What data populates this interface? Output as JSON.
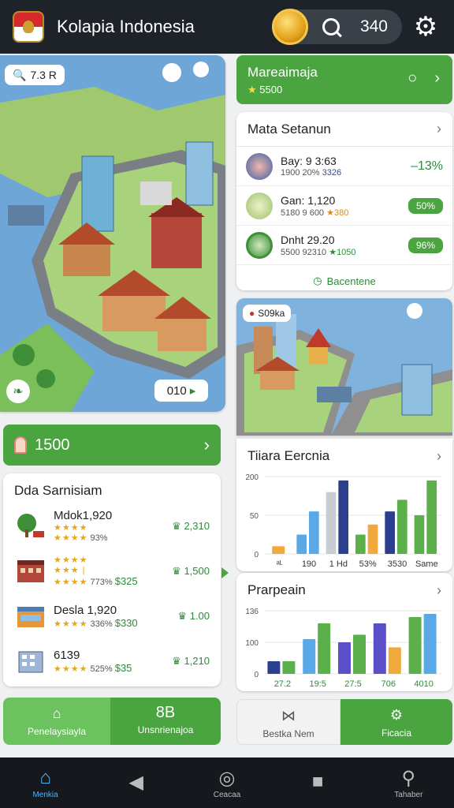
{
  "header": {
    "title": "Kolapia Indonesia",
    "coin_count": "340"
  },
  "map": {
    "tag": "7.3 R",
    "bottom_badge": "010"
  },
  "left_banner": {
    "value": "1500"
  },
  "right_banner": {
    "title": "Mareaimaja",
    "subtitle": "5500"
  },
  "stats": {
    "title": "Mata Setanun",
    "rows": [
      {
        "main": "Bay: 9 3:63",
        "sub_a": "1900 20%",
        "sub_b": "3326",
        "right": "–13%"
      },
      {
        "main": "Gan: 1,120",
        "sub_a": "5180 9 600",
        "sub_b": "380",
        "right": "50%"
      },
      {
        "main": "Dnht 29.20",
        "sub_a": "5500 92310",
        "sub_b": "1050",
        "right": "96%"
      }
    ],
    "link": "Bacentene"
  },
  "city_tag": "S09ka",
  "list": {
    "title": "Dda Sarnisiam",
    "items": [
      {
        "name": "Mdok1,920",
        "stars_a": "★★★★",
        "stars_b": "★★★★",
        "sub": "93%",
        "price": "2,310"
      },
      {
        "name": "",
        "stars_a": "★★★★",
        "stars_b": "★★★ |",
        "stars_c": "★★★★",
        "sub": "773%",
        "sub_b": "$325",
        "price": "1,500"
      },
      {
        "name": "Desla 1,920",
        "stars_a": "★★★★",
        "sub": "336%",
        "sub_b": "$330",
        "price": "1.00"
      },
      {
        "name": "6139",
        "stars_a": "★★★★",
        "sub": "525%",
        "sub_b": "$35",
        "price": "1,210"
      }
    ]
  },
  "tabs": {
    "left_a": "Penelaysiayla",
    "left_b_icon": "8B",
    "left_b": "Unsnrienajoa",
    "right_a": "Bestka Nem",
    "right_b": "Ficacia"
  },
  "nav": {
    "home": "Menkia",
    "center": "Ceacaa",
    "search": "Tahaber"
  },
  "chart_data": [
    {
      "type": "bar",
      "title": "Tiiara Eercnia",
      "yticks": [
        "200",
        "50",
        "0"
      ],
      "categories": [
        "ᵃᴸ",
        "190",
        "1 Hd",
        "53%",
        "3530",
        "Same"
      ],
      "series": [
        {
          "color": "#f2a93b",
          "values": [
            10,
            0,
            0,
            0,
            0,
            0
          ]
        },
        {
          "color": "#5aa9e6",
          "values": [
            0,
            25,
            55,
            0,
            0,
            0
          ]
        },
        {
          "color": "#c8cdd4",
          "values": [
            0,
            0,
            80,
            0,
            0,
            0
          ]
        },
        {
          "color": "#2c3f8f",
          "values": [
            0,
            0,
            95,
            0,
            0,
            0
          ]
        },
        {
          "color": "#5cb04b",
          "values": [
            0,
            0,
            0,
            25,
            70,
            95
          ]
        },
        {
          "color": "#f2a93b",
          "values": [
            0,
            0,
            0,
            38,
            0,
            0
          ]
        },
        {
          "color": "#2c3f8f",
          "values": [
            0,
            0,
            0,
            0,
            55,
            0
          ]
        }
      ],
      "bars": [
        {
          "cat": 0,
          "v": 10,
          "color": "#f2a93b"
        },
        {
          "cat": 1,
          "v": 25,
          "color": "#5aa9e6"
        },
        {
          "cat": 1,
          "v": 55,
          "color": "#5aa9e6"
        },
        {
          "cat": 2,
          "v": 80,
          "color": "#c8cdd4"
        },
        {
          "cat": 2,
          "v": 95,
          "color": "#2c3f8f"
        },
        {
          "cat": 3,
          "v": 25,
          "color": "#5cb04b"
        },
        {
          "cat": 3,
          "v": 38,
          "color": "#f2a93b"
        },
        {
          "cat": 4,
          "v": 55,
          "color": "#2c3f8f"
        },
        {
          "cat": 4,
          "v": 70,
          "color": "#5cb04b"
        },
        {
          "cat": 5,
          "v": 50,
          "color": "#5cb04b"
        },
        {
          "cat": 5,
          "v": 95,
          "color": "#5cb04b"
        }
      ],
      "ylim": [
        0,
        100
      ]
    },
    {
      "type": "bar",
      "title": "Prarpeain",
      "yticks": [
        "136",
        "100",
        "0"
      ],
      "categories": [
        "27.2",
        "19:5",
        "27:5",
        "706",
        "4010"
      ],
      "bars": [
        {
          "cat": 0,
          "v": 20,
          "color": "#2c3f8f"
        },
        {
          "cat": 0,
          "v": 20,
          "color": "#5cb04b"
        },
        {
          "cat": 1,
          "v": 55,
          "color": "#5aa9e6"
        },
        {
          "cat": 1,
          "v": 80,
          "color": "#5cb04b"
        },
        {
          "cat": 2,
          "v": 50,
          "color": "#5a4fc9"
        },
        {
          "cat": 2,
          "v": 62,
          "color": "#5cb04b"
        },
        {
          "cat": 3,
          "v": 80,
          "color": "#5a4fc9"
        },
        {
          "cat": 3,
          "v": 42,
          "color": "#f2a93b"
        },
        {
          "cat": 4,
          "v": 90,
          "color": "#5cb04b"
        },
        {
          "cat": 4,
          "v": 95,
          "color": "#5aa9e6"
        }
      ],
      "ylim": [
        0,
        100
      ]
    }
  ]
}
